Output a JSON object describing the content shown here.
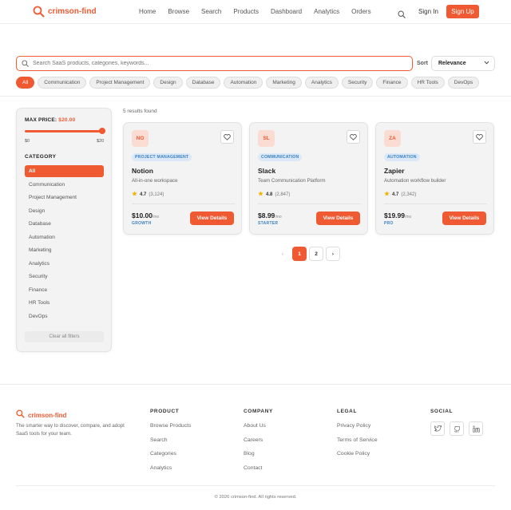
{
  "brand": {
    "name": "crimson-find",
    "color": "#f05a33"
  },
  "nav": {
    "items": [
      "Home",
      "Browse",
      "Search",
      "Products",
      "Dashboard",
      "Analytics",
      "Orders"
    ],
    "signin": "Sign In",
    "signup": "Sign Up"
  },
  "search": {
    "placeholder": "Search SaaS products, categories, keywords...",
    "sort_label": "Sort",
    "sort_value": "Relevance"
  },
  "chips": [
    "All",
    "Communication",
    "Project Management",
    "Design",
    "Database",
    "Automation",
    "Marketing",
    "Analytics",
    "Security",
    "Finance",
    "HR Tools",
    "DevOps"
  ],
  "sidebar": {
    "max_price_label": "MAX PRICE:",
    "max_price_value": "$20.00",
    "slider_fraction": 1.0,
    "slider_min": "$0",
    "slider_max": "$20",
    "category_title": "CATEGORY",
    "categories": [
      "All",
      "Communication",
      "Project Management",
      "Design",
      "Database",
      "Automation",
      "Marketing",
      "Analytics",
      "Security",
      "Finance",
      "HR Tools",
      "DevOps"
    ],
    "clear": "Clear all filters"
  },
  "results": {
    "count_text": "5 results found",
    "products": [
      {
        "initials": "NO",
        "tag": "PROJECT MANAGEMENT",
        "name": "Notion",
        "desc": "All-in-one workspace",
        "rating": "4.7",
        "reviews": "(3,124)",
        "price": "$10.00",
        "per": "/mo",
        "plan": "GROWTH",
        "cta": "View Details"
      },
      {
        "initials": "SL",
        "tag": "COMMUNICATION",
        "name": "Slack",
        "desc": "Team Communication Platform",
        "rating": "4.8",
        "reviews": "(2,847)",
        "price": "$8.99",
        "per": "/mo",
        "plan": "STARTER",
        "cta": "View Details"
      },
      {
        "initials": "ZA",
        "tag": "AUTOMATION",
        "name": "Zapier",
        "desc": "Automation workflow builder",
        "rating": "4.7",
        "reviews": "(2,342)",
        "price": "$19.99",
        "per": "/mo",
        "plan": "PRO",
        "cta": "View Details"
      }
    ]
  },
  "pagination": {
    "prev": "‹",
    "pages": [
      "1",
      "2"
    ],
    "next": "›",
    "current": "1"
  },
  "footer": {
    "tagline": "The smarter way to discover, compare, and adopt SaaS tools for your team.",
    "product": {
      "title": "PRODUCT",
      "links": [
        "Browse Products",
        "Search",
        "Categories",
        "Analytics"
      ]
    },
    "company": {
      "title": "COMPANY",
      "links": [
        "About Us",
        "Careers",
        "Blog",
        "Contact"
      ]
    },
    "legal": {
      "title": "LEGAL",
      "links": [
        "Privacy Policy",
        "Terms of Service",
        "Cookie Policy"
      ]
    },
    "social": {
      "title": "SOCIAL",
      "icons": [
        "twitter-icon",
        "github-icon",
        "linkedin-icon"
      ]
    },
    "copyright": "© 2026 crimson-find. All rights reserved."
  }
}
